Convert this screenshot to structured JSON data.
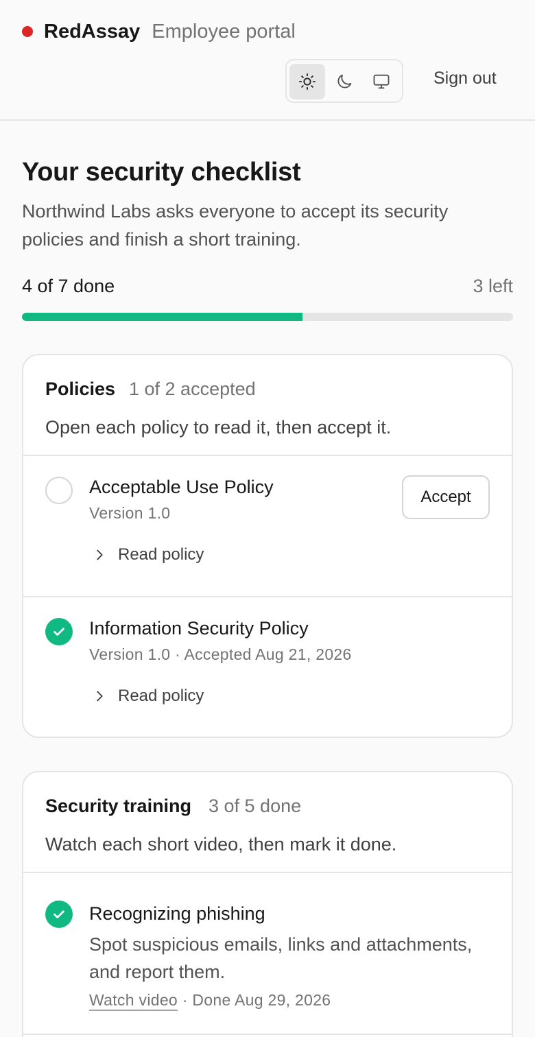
{
  "header": {
    "brand": "RedAssay",
    "subtitle": "Employee portal",
    "theme_options": [
      {
        "name": "light",
        "icon": "sun-icon",
        "selected": true
      },
      {
        "name": "dark",
        "icon": "moon-icon",
        "selected": false
      },
      {
        "name": "system",
        "icon": "monitor-icon",
        "selected": false
      }
    ],
    "sign_out": "Sign out"
  },
  "main": {
    "title": "Your security checklist",
    "intro": "Northwind Labs asks everyone to accept its security policies and finish a short training.",
    "progress": {
      "label": "4 of 7 done",
      "remaining": "3 left",
      "done": 4,
      "total": 7
    }
  },
  "policies": {
    "title": "Policies",
    "count": "1 of 2 accepted",
    "description": "Open each policy to read it, then accept it.",
    "items": [
      {
        "title": "Acceptable Use Policy",
        "meta": "Version 1.0",
        "accepted": false,
        "action": "Accept",
        "link": "Read policy"
      },
      {
        "title": "Information Security Policy",
        "meta": "Version 1.0 · Accepted Aug 21, 2026",
        "accepted": true,
        "link": "Read policy"
      }
    ]
  },
  "training": {
    "title": "Security training",
    "count": "3 of 5 done",
    "description": "Watch each short video, then mark it done.",
    "items": [
      {
        "title": "Recognizing phishing",
        "description": "Spot suspicious emails, links and attachments, and report them.",
        "link": "Watch video",
        "status": " · Done Aug 29, 2026",
        "done": true
      }
    ]
  },
  "colors": {
    "accent": "#10b981",
    "brand_dot": "#dc2626",
    "border": "#e5e5e5"
  }
}
